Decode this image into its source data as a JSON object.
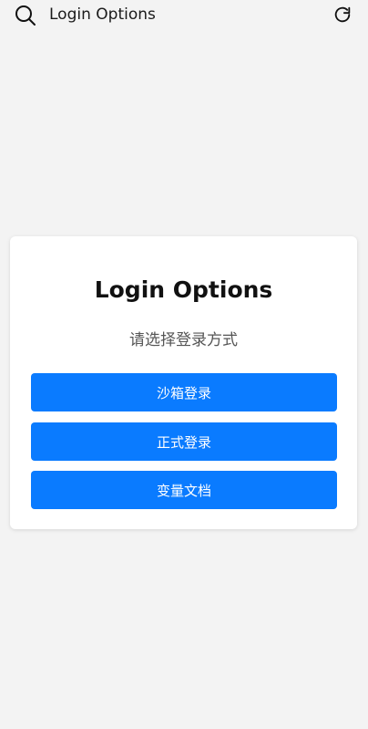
{
  "header": {
    "title": "Login Options",
    "search_icon": "search-icon",
    "refresh_icon": "refresh-icon"
  },
  "card": {
    "title": "Login Options",
    "subtitle": "请选择登录方式",
    "buttons": [
      {
        "label": "沙箱登录"
      },
      {
        "label": "正式登录"
      },
      {
        "label": "变量文档"
      }
    ]
  },
  "colors": {
    "background": "#f3f3f3",
    "card": "#ffffff",
    "accent": "#0a7bff",
    "button_text": "#ffffff"
  }
}
